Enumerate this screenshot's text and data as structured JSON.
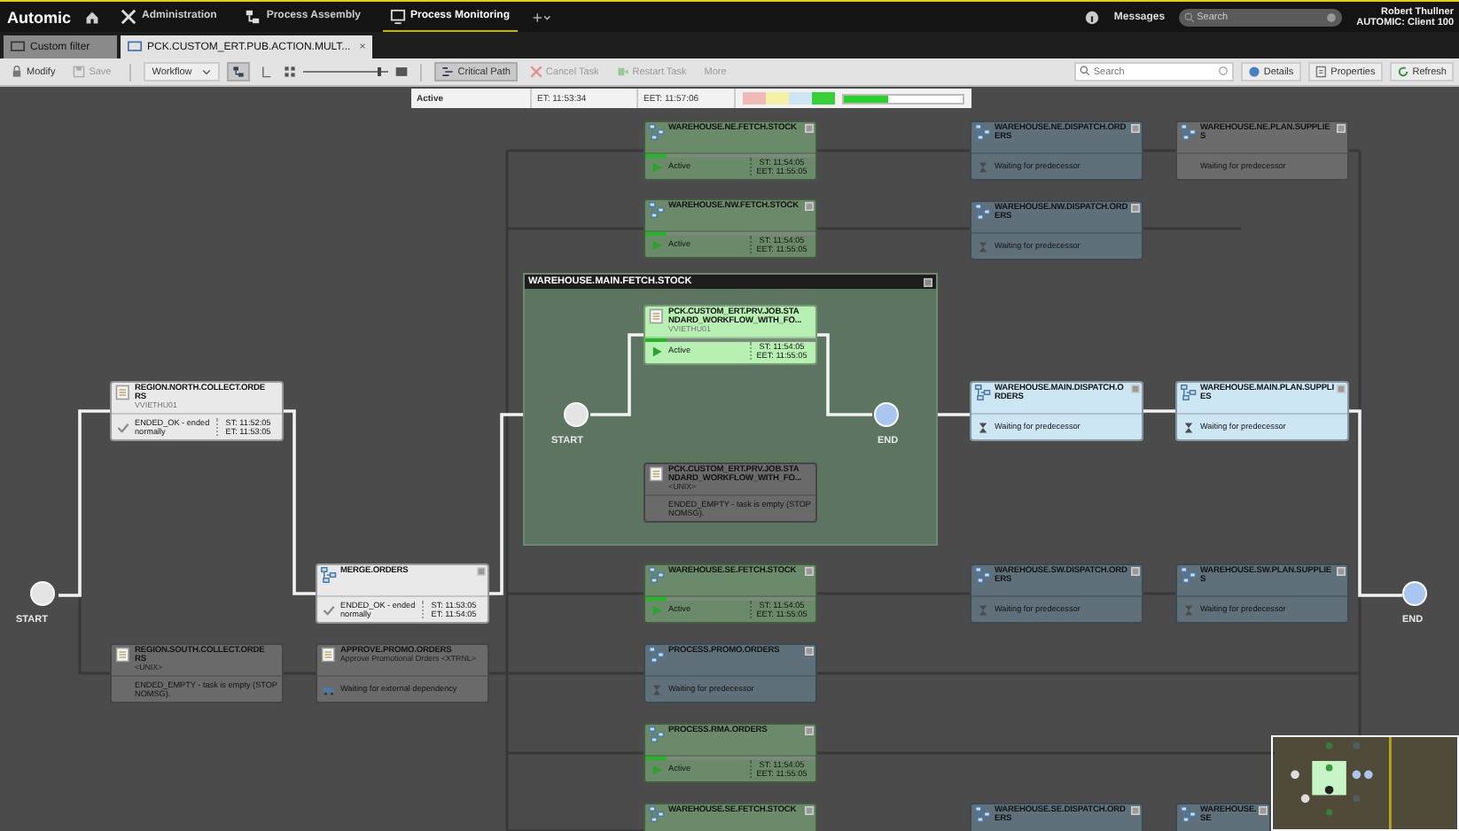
{
  "topbar": {
    "logo": "Automic",
    "nav": [
      {
        "label": "Administration",
        "selected": false
      },
      {
        "label": "Process Assembly",
        "selected": false
      },
      {
        "label": "Process Monitoring",
        "selected": true
      }
    ],
    "messages": "Messages",
    "search": {
      "placeholder": "Search"
    },
    "user": "Robert Thullner",
    "client": "AUTOMIC: Client 100"
  },
  "tabs": [
    {
      "label": "Custom filter",
      "selected": false
    },
    {
      "label": "PCK.CUSTOM_ERT.PUB.ACTION.MULT...",
      "selected": true,
      "close": "×"
    }
  ],
  "toolbar": {
    "buttons": [
      {
        "label": "Modify",
        "disabled": false
      },
      {
        "label": "Save",
        "disabled": true
      }
    ],
    "view": "Workflow",
    "view_toggles": [
      {
        "selected": true
      },
      {
        "selected": false
      }
    ],
    "zoom": {
      "level": 0.9
    },
    "actions": [
      {
        "label": "Critical Path",
        "pressed": true,
        "disabled": false
      },
      {
        "label": "Cancel Task",
        "pressed": false,
        "disabled": true
      },
      {
        "label": "Restart Task",
        "pressed": false,
        "disabled": true
      },
      {
        "label": "More",
        "pressed": false,
        "disabled": true
      }
    ],
    "search": {
      "placeholder": "Search"
    },
    "right_buttons": [
      {
        "label": "Details"
      },
      {
        "label": "Properties"
      },
      {
        "label": "Refresh"
      }
    ]
  },
  "status_strip": {
    "state": "Active",
    "et": "ET: 11:53:34",
    "eet": "EET: 11:57:06",
    "legend": [
      {
        "color": "#f2b9b9"
      },
      {
        "color": "#f4f0a6"
      },
      {
        "color": "#cfe5f4"
      },
      {
        "color": "#39cf39"
      }
    ],
    "progress": {
      "level": 0.38
    }
  },
  "start": {
    "label": "START"
  },
  "end": {
    "label": "END"
  },
  "tasks": [
    {
      "workflow": false,
      "title": "REGION.NORTH.COLLECT.ORDERS",
      "subtitle": "VVIETHU01",
      "kind": "ok",
      "highlighted": true,
      "status_text": "ENDED_OK - ended normally",
      "st": "ST: 11:52:05",
      "et": "ET: 11:53:05"
    },
    {
      "workflow": false,
      "title": "REGION.SOUTH.COLLECT.ORDERS",
      "subtitle": "<UNIX>",
      "kind": "empty",
      "highlighted": false,
      "status_text": "ENDED_EMPTY - task is empty (STOP NOMSG)."
    },
    {
      "workflow": true,
      "title": "MERGE.ORDERS",
      "kind": "ok",
      "highlighted": true,
      "status_text": "ENDED_OK - ended normally",
      "st": "ST: 11:53:05",
      "et": "ET: 11:54:05"
    },
    {
      "workflow": false,
      "title": "APPROVE.PROMO.ORDERS",
      "subtitle": "Approve Promotional Orders <XTRNL>",
      "kind": "external",
      "highlighted": false,
      "status_text": "Waiting for external dependency"
    },
    {
      "workflow": true,
      "title": "WAREHOUSE.NE.FETCH.STOCK",
      "kind": "active",
      "highlighted": false,
      "level": 0.13,
      "status_text": "Active",
      "st": "ST: 11:54:05",
      "et": "EET: 11:55:05"
    },
    {
      "workflow": true,
      "title": "WAREHOUSE.NW.FETCH.STOCK",
      "kind": "active",
      "highlighted": false,
      "level": 0.13,
      "status_text": "Active",
      "st": "ST: 11:54:05",
      "et": "EET: 11:55:05"
    },
    {
      "workflow": true,
      "title": "WAREHOUSE.SE.FETCH.STOCK",
      "kind": "active",
      "highlighted": false,
      "level": 0.13,
      "status_text": "Active",
      "st": "ST: 11:54:05",
      "et": "EET: 11:55:05"
    },
    {
      "workflow": true,
      "title": "PROCESS.PROMO.ORDERS",
      "kind": "waiting",
      "highlighted": false,
      "status_text": "Waiting for predecessor"
    },
    {
      "workflow": true,
      "title": "PROCESS.RMA.ORDERS",
      "kind": "active",
      "highlighted": false,
      "level": 0.13,
      "status_text": "Active",
      "st": "ST: 11:54:05",
      "et": "EET: 11:55:05"
    },
    {
      "workflow": true,
      "title": "WAREHOUSE.SE.FETCH.STOCK",
      "kind": "active",
      "highlighted": false
    },
    {
      "workflow": true,
      "title": "WAREHOUSE.NE.DISPATCH.ORDERS",
      "kind": "waiting",
      "highlighted": false,
      "status_text": "Waiting for predecessor"
    },
    {
      "workflow": true,
      "title": "WAREHOUSE.NW.DISPATCH.ORDERS",
      "kind": "waiting",
      "highlighted": false,
      "status_text": "Waiting for predecessor"
    },
    {
      "workflow": true,
      "title": "WAREHOUSE.MAIN.DISPATCH.ORDERS",
      "kind": "waiting",
      "highlighted": true,
      "status_text": "Waiting for predecessor"
    },
    {
      "workflow": true,
      "title": "WAREHOUSE.SW.DISPATCH.ORDERS",
      "kind": "waiting",
      "highlighted": false,
      "status_text": "Waiting for predecessor"
    },
    {
      "workflow": true,
      "title": "WAREHOUSE.SE.DISPATCH.ORDERS",
      "kind": "waiting",
      "highlighted": false
    },
    {
      "workflow": true,
      "title": "WAREHOUSE.NE.PLAN.SUPPLIES",
      "kind": "pending",
      "highlighted": false,
      "status_text": "Waiting for predecessor"
    },
    {
      "workflow": true,
      "title": "WAREHOUSE.MAIN.PLAN.SUPPLIES",
      "kind": "waiting",
      "highlighted": true,
      "status_text": "Waiting for predecessor"
    },
    {
      "workflow": true,
      "title": "WAREHOUSE.SW.PLAN.SUPPLIES",
      "kind": "waiting",
      "highlighted": false,
      "status_text": "Waiting for predecessor"
    },
    {
      "workflow": true,
      "title": "WAREHOUSE.SE",
      "kind": "waiting",
      "highlighted": false
    }
  ],
  "group": {
    "title": "WAREHOUSE.MAIN.FETCH.STOCK",
    "start": "START",
    "end": "END",
    "tasks": [
      {
        "workflow": false,
        "title": "PCK.CUSTOM_ERT.PRV.JOB.STANDARD_WORKFLOW_WITH_FO...",
        "subtitle": "VVIETHU01",
        "kind": "active",
        "highlighted": true,
        "level": 0.13,
        "status_text": "Active",
        "st": "ST: 11:54:05",
        "et": "EET: 11:55:05"
      },
      {
        "workflow": false,
        "title": "PCK.CUSTOM_ERT.PRV.JOB.STANDARD_WORKFLOW_WITH_FO...",
        "subtitle": "<UNIX>",
        "kind": "empty",
        "highlighted": false,
        "status_text": "ENDED_EMPTY - task is empty (STOP NOMSG)."
      }
    ]
  }
}
